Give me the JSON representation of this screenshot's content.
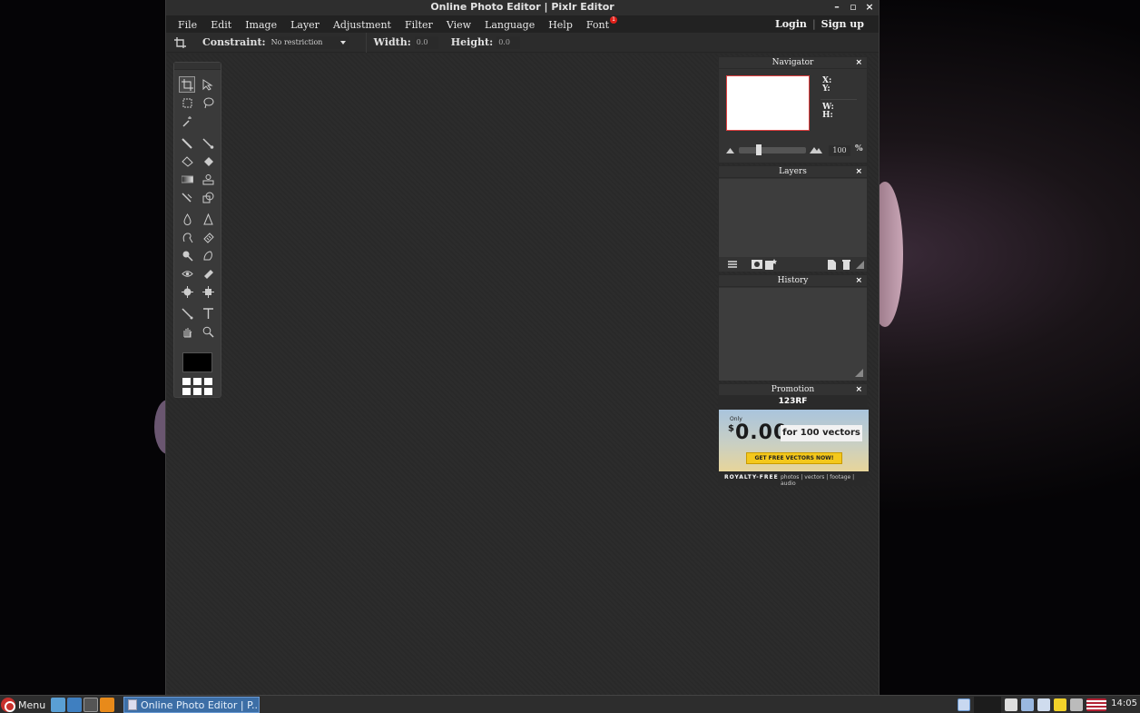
{
  "window": {
    "title": "Online Photo Editor | Pixlr Editor",
    "controls": [
      "minimize",
      "maximize",
      "close"
    ]
  },
  "menubar": {
    "items": [
      "File",
      "Edit",
      "Image",
      "Layer",
      "Adjustment",
      "Filter",
      "View",
      "Language",
      "Help",
      "Font"
    ],
    "font_badge": "1",
    "login": "Login",
    "separator": "|",
    "signup": "Sign up"
  },
  "options": {
    "constraint_label": "Constraint:",
    "constraint_value": "No restriction",
    "width_label": "Width:",
    "width_value": "0.0",
    "height_label": "Height:",
    "height_value": "0.0"
  },
  "tools": {
    "items": [
      "crop-tool",
      "move-tool",
      "marquee-tool",
      "lasso-tool",
      "wand-tool",
      "pencil-tool",
      "brush-tool",
      "eraser-tool",
      "bucket-tool",
      "gradient-tool",
      "clone-stamp-tool",
      "color-replace-tool",
      "drawing-tool",
      "blur-tool",
      "sharpen-tool",
      "smudge-tool",
      "sponge-tool",
      "dodge-tool",
      "burn-tool",
      "red-eye-tool",
      "spot-heal-tool",
      "bloat-tool",
      "pinch-tool",
      "color-picker-tool",
      "type-tool",
      "hand-tool",
      "zoom-tool"
    ],
    "primary_color": "#000000"
  },
  "navigator": {
    "title": "Navigator",
    "x_label": "X:",
    "y_label": "Y:",
    "w_label": "W:",
    "h_label": "H:",
    "zoom": "100",
    "zoom_unit": "%"
  },
  "layers": {
    "title": "Layers"
  },
  "history": {
    "title": "History"
  },
  "promotion": {
    "title": "Promotion",
    "brand": "123RF",
    "only": "Only",
    "price": "0.00",
    "currency": "$",
    "tagline": "for 100 vectors",
    "cta": "GET FREE VECTORS NOW!",
    "footer_left": "ROYALTY-FREE",
    "footer_right": "photos | vectors | footage | audio"
  },
  "taskbar": {
    "menu_label": "Menu",
    "task_title": "Online Photo Editor | P...",
    "clock": "14:05"
  },
  "colors": {
    "accent": "#3c6ea6",
    "badge": "#e0201a",
    "cta": "#f4c81c"
  }
}
